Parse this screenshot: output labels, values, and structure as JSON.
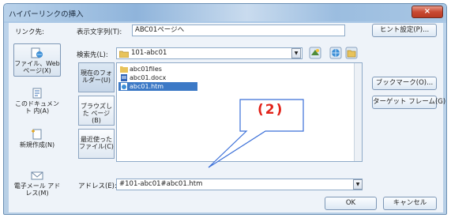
{
  "window": {
    "title": "ハイパーリンクの挿入",
    "close_glyph": "×"
  },
  "link_label": "リンク先:",
  "display_text": {
    "label": "表示文字列(T):",
    "value": "ABC01ページへ"
  },
  "tooltip_button": "ヒント設定(P)...",
  "look_in": {
    "label": "検索先(L):",
    "value": "101-abc01"
  },
  "link_targets": [
    {
      "label": "ファイル、Web ページ(X)",
      "icon": "globe-page-icon"
    },
    {
      "label": "このドキュメント 内(A)",
      "icon": "document-icon"
    },
    {
      "label": "新規作成(N)",
      "icon": "new-document-icon"
    },
    {
      "label": "電子メール アドレス(M)",
      "icon": "email-icon"
    }
  ],
  "places": [
    {
      "label": "現在のフォ ルダー(U)"
    },
    {
      "label": "ブラウズした ページ(B)"
    },
    {
      "label": "最近使った ファイル(C)"
    }
  ],
  "files": [
    {
      "name": "abc01files",
      "icon": "folder-icon"
    },
    {
      "name": "abc01.docx",
      "icon": "word-doc-icon"
    },
    {
      "name": "abc01.htm",
      "icon": "html-file-icon"
    }
  ],
  "right_buttons": {
    "bookmark": "ブックマーク(O)...",
    "target_frame": "ターゲット フレーム(G)..."
  },
  "address": {
    "label": "アドレス(E):",
    "value": "#101-abc01#abc01.htm"
  },
  "footer": {
    "ok": "OK",
    "cancel": "キャンセル"
  },
  "annotation": {
    "text": "(2)",
    "color": "#e2231a",
    "border_color": "#3a6fd8"
  }
}
